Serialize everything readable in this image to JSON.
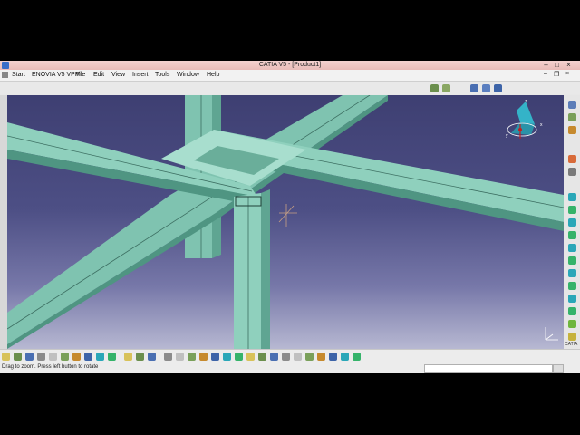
{
  "window": {
    "title": "CATIA V5 - [Product1]",
    "controls": {
      "minimize": "–",
      "maximize": "□",
      "close": "×"
    }
  },
  "menu": {
    "items": [
      "Start",
      "ENOVIA V5 VPM",
      "File",
      "Edit",
      "View",
      "Insert",
      "Tools",
      "Window",
      "Help"
    ],
    "mdi_controls": {
      "minimize": "–",
      "restore": "❐",
      "close": "×"
    }
  },
  "status": {
    "message": "Drag to zoom. Press left button to rotate",
    "command_input": ""
  },
  "compass": {
    "x_label": "x",
    "y_label": "y",
    "z_label": "z"
  },
  "brand": {
    "logo_text": "CATIA"
  },
  "colors": {
    "beam": "#7fc3b0",
    "beam_dark": "#4f9582",
    "beam_light": "#b7e6d8",
    "background_top": "#3e3f72",
    "background_bottom": "#b7b8d2",
    "titlebar": "#e9bcb8"
  },
  "toolbar_icons": {
    "bottom": [
      "new-icon",
      "open-icon",
      "save-icon",
      "print-icon",
      "cut-icon",
      "copy-icon",
      "paste-icon",
      "undo-icon",
      "redo-icon",
      "whats-this-icon",
      "formula-icon",
      "knowledge-icon",
      "catalog-icon",
      "sketch-icon",
      "fly-icon",
      "pan-icon",
      "rotate-icon",
      "zoom-in-icon",
      "zoom-out-icon",
      "normal-view-icon",
      "iso-view-icon",
      "shading-icon",
      "hide-show-icon",
      "swap-space-icon",
      "render-icon",
      "material-icon",
      "measure-icon",
      "analysis-icon",
      "compass-icon",
      "lock-icon"
    ],
    "right": [
      "product-icon",
      "part-icon",
      "component-icon",
      "constraint-icon",
      "fix-icon",
      "coincidence-icon",
      "contact-icon",
      "offset-icon",
      "angle-icon",
      "update-icon",
      "explode-icon",
      "snap-icon",
      "manipulate-icon",
      "clash-icon",
      "section-icon",
      "distance-icon",
      "bom-icon",
      "catalog-browser-icon",
      "scene-icon",
      "axis-system-icon"
    ],
    "top": [
      "space-analysis-icon",
      "clash-detection-icon",
      "insert-component-icon",
      "existing-component-icon",
      "replace-component-icon"
    ]
  }
}
